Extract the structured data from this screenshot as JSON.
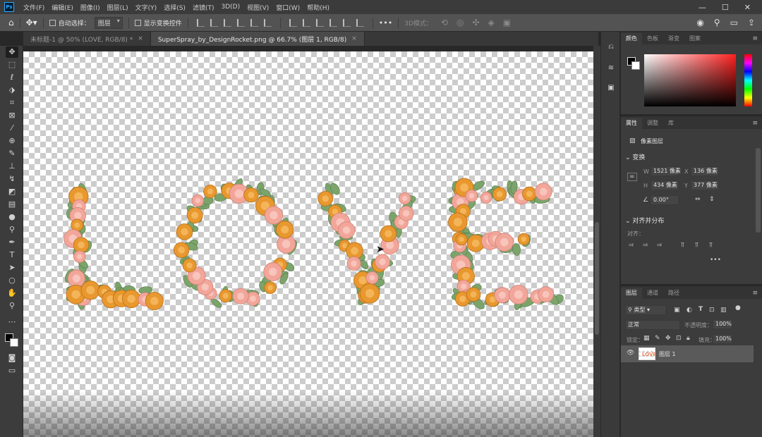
{
  "menubar": {
    "logo": "Ps",
    "items": [
      "文件(F)",
      "编辑(E)",
      "图像(I)",
      "图层(L)",
      "文字(Y)",
      "选择(S)",
      "滤镜(T)",
      "3D(D)",
      "视图(V)",
      "窗口(W)",
      "帮助(H)"
    ],
    "controls": [
      "—",
      "☐",
      "✕"
    ]
  },
  "options_bar": {
    "auto_select_label": "自动选择：",
    "auto_select_value": "图层",
    "show_transform_label": "显示变换控件",
    "more": "•••",
    "mode_3d": "3D模式："
  },
  "document_tabs": [
    {
      "label": "未标题-1 @ 50% (LOVE, RGB/8) *",
      "active": false
    },
    {
      "label": "SuperSpray_by_DesignRocket.png @ 66.7% (图层 1, RGB/8)",
      "active": true
    }
  ],
  "tab_close": "×",
  "canvas": {
    "artwork_text": "LOVE"
  },
  "color_panel": {
    "tabs": [
      "颜色",
      "色板",
      "渐变",
      "图案"
    ],
    "foreground": "#000000",
    "background": "#ffffff",
    "menu": "≡"
  },
  "properties_panel": {
    "tabs": [
      "属性",
      "调整",
      "库"
    ],
    "layer_type": "像素图层",
    "transform_title": "变换",
    "w_label": "W",
    "w_value": "1521 像素",
    "x_label": "X",
    "x_value": "136 像素",
    "h_label": "H",
    "h_value": "434 像素",
    "y_label": "Y",
    "y_value": "377 像素",
    "angle_value": "0.00°",
    "align_title": "对齐并分布",
    "align_label": "对齐：",
    "more": "•••"
  },
  "layers_panel": {
    "tabs": [
      "图层",
      "通道",
      "路径"
    ],
    "filter_label": "类型",
    "blend_mode": "正常",
    "opacity_label": "不透明度：",
    "opacity_value": "100%",
    "lock_label": "锁定：",
    "fill_label": "填充：",
    "fill_value": "100%",
    "layers": [
      {
        "name": "图层 1",
        "visible": true
      }
    ]
  },
  "colors": {
    "orange": "#e8982e",
    "pink": "#f2a69a",
    "leaf": "#7ba46a",
    "active_tab": "#4a4a4a"
  }
}
